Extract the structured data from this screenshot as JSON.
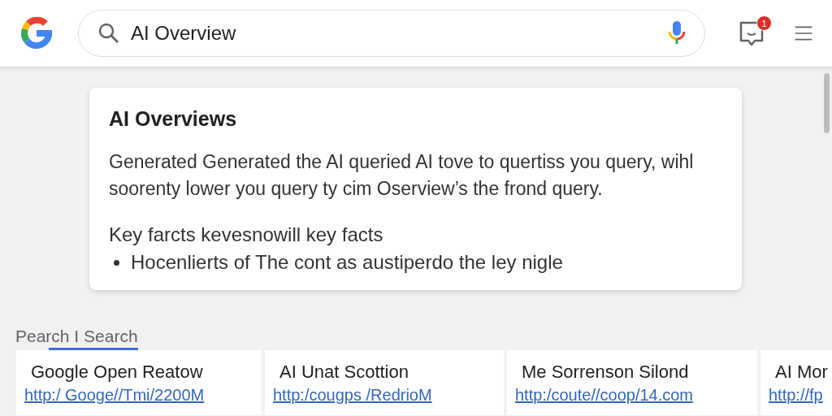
{
  "search": {
    "value": "AI Overview"
  },
  "notifications": {
    "badge": "1"
  },
  "overview": {
    "title": "AI Overviews",
    "summary": "Generated Generated the AI queried AI tove to quertiss you query, wihl soorenty lower you query ty cim Oserview’s the frond query.",
    "key_facts_heading": "Key farcts kevesnowill key facts",
    "bullets": [
      "Hocenlierts of The cont as austiperdo the ley nigle"
    ]
  },
  "tabs": [
    {
      "label": "Pearch I Search",
      "selected": true
    }
  ],
  "results": [
    {
      "title": "Google Open Reatow",
      "url": "http:/ Googe//Tmi/2200M"
    },
    {
      "title": "AI Unat Scottion",
      "url": "http:/cougps /RedrioM"
    },
    {
      "title": "Me Sorrenson Silond",
      "url": "http:/coute//coop/14.com"
    },
    {
      "title": "AI Mor",
      "url": "http://fp"
    }
  ]
}
